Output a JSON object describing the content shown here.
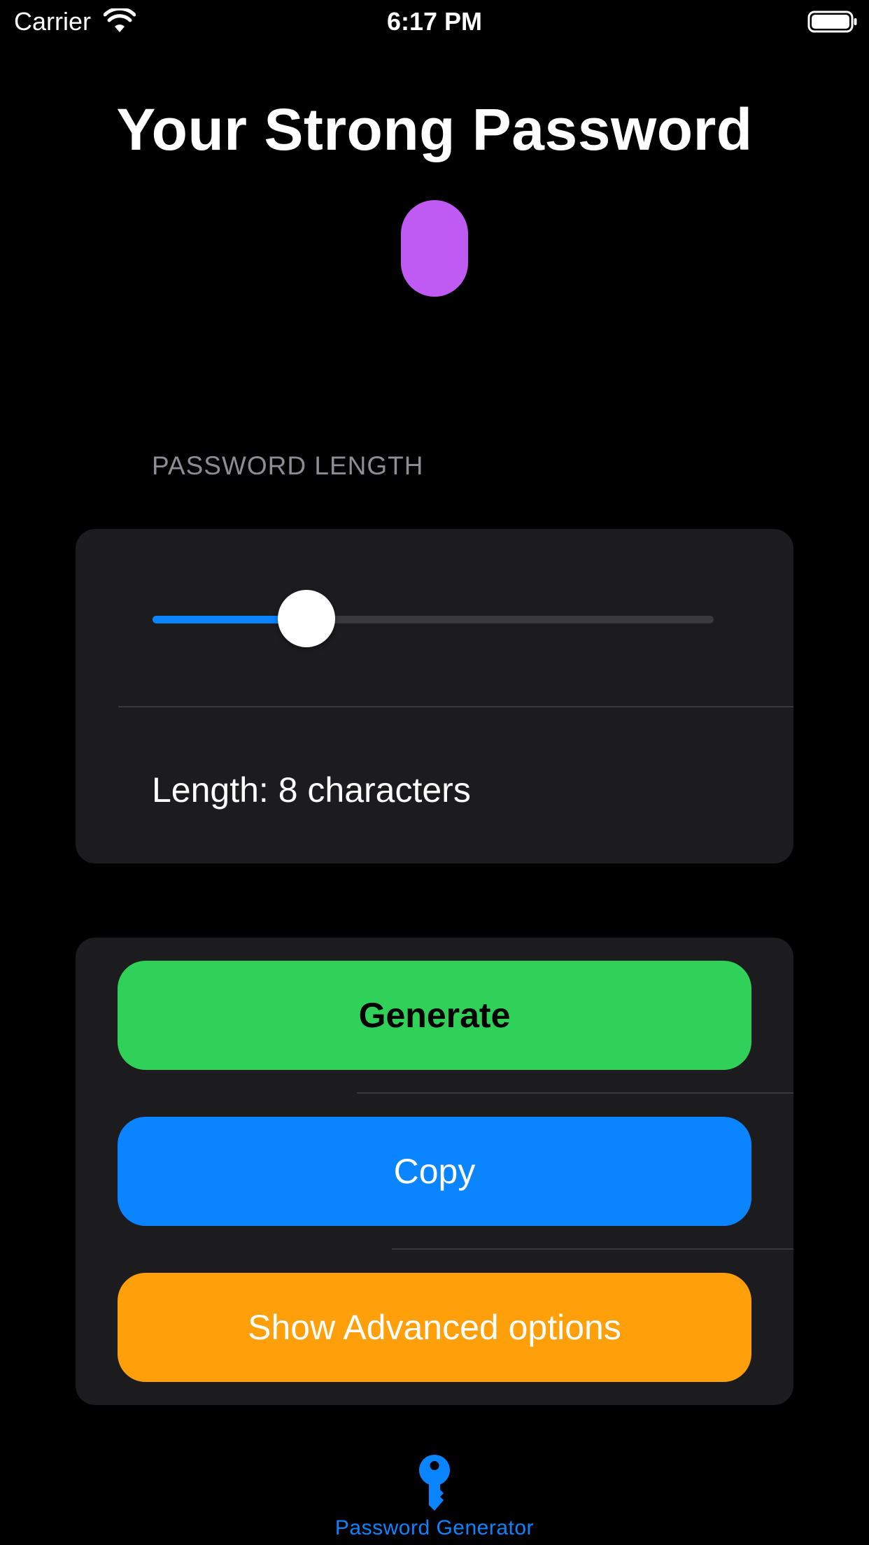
{
  "status_bar": {
    "carrier": "Carrier",
    "time": "6:17 PM",
    "wifi_icon": "wifi-icon",
    "battery_icon": "battery-full-icon"
  },
  "header": {
    "title": "Your Strong Password",
    "password_value": ""
  },
  "length_section": {
    "header": "PASSWORD LENGTH",
    "slider_fraction": 0.2745,
    "length_label": "Length: 8 characters"
  },
  "actions": {
    "generate_label": "Generate",
    "copy_label": "Copy",
    "advanced_label": "Show Advanced options"
  },
  "tab_bar": {
    "items": [
      {
        "label": "Password Generator",
        "icon": "key-icon",
        "selected": true
      }
    ]
  },
  "colors": {
    "background": "#000000",
    "card": "#1c1c1e",
    "accent_blue": "#0a84ff",
    "generate_green": "#30d158",
    "advanced_orange": "#ff9f0a",
    "password_purple": "#bf5af2",
    "secondary_label": "#8d8d93"
  }
}
